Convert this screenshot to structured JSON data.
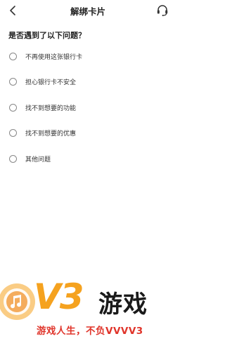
{
  "header": {
    "title": "解绑卡片",
    "back_icon": "chevron-left-icon",
    "support_icon": "headset-icon"
  },
  "question": "是否遇到了以下问题？",
  "options": [
    {
      "label": "不再使用这张银行卡",
      "selected": false
    },
    {
      "label": "担心银行卡不安全",
      "selected": false
    },
    {
      "label": "找不到想要的功能",
      "selected": false
    },
    {
      "label": "找不到想要的优惠",
      "selected": false
    },
    {
      "label": "其他问题",
      "selected": false
    }
  ],
  "watermark": {
    "logo_text": "V3",
    "name": "游戏",
    "slogan": "游戏人生，不负VVVV3"
  },
  "colors": {
    "watermark_orange": "#f5a21f",
    "watermark_red": "#e0352b",
    "radio_border": "#888888"
  }
}
